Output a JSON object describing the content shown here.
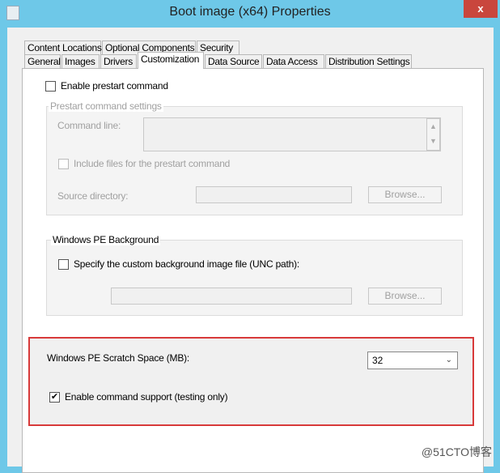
{
  "window": {
    "title": "Boot image (x64) Properties",
    "close_label": "x"
  },
  "tabs_row1": [
    "Content Locations",
    "Optional Components",
    "Security"
  ],
  "tabs_row2": [
    "General",
    "Images",
    "Drivers",
    "Customization",
    "Data Source",
    "Data Access",
    "Distribution Settings"
  ],
  "selected_tab": "Customization",
  "prestart": {
    "enable_label": "Enable prestart command",
    "enabled": false,
    "group_title": "Prestart command settings",
    "command_line_label": "Command line:",
    "command_line_value": "",
    "include_files_label": "Include files for the prestart command",
    "include_files_checked": false,
    "source_dir_label": "Source directory:",
    "source_dir_value": "",
    "browse_label": "Browse..."
  },
  "background": {
    "group_title": "Windows PE Background",
    "specify_label": "Specify the custom background image file (UNC path):",
    "specify_checked": false,
    "path_value": "",
    "browse_label": "Browse..."
  },
  "scratch": {
    "label": "Windows PE Scratch Space (MB):",
    "value": "32",
    "cmd_support_label": "Enable command support (testing only)",
    "cmd_support_checked": true
  },
  "highlight_color": "#d83a3a",
  "watermark": "@51CTO博客"
}
